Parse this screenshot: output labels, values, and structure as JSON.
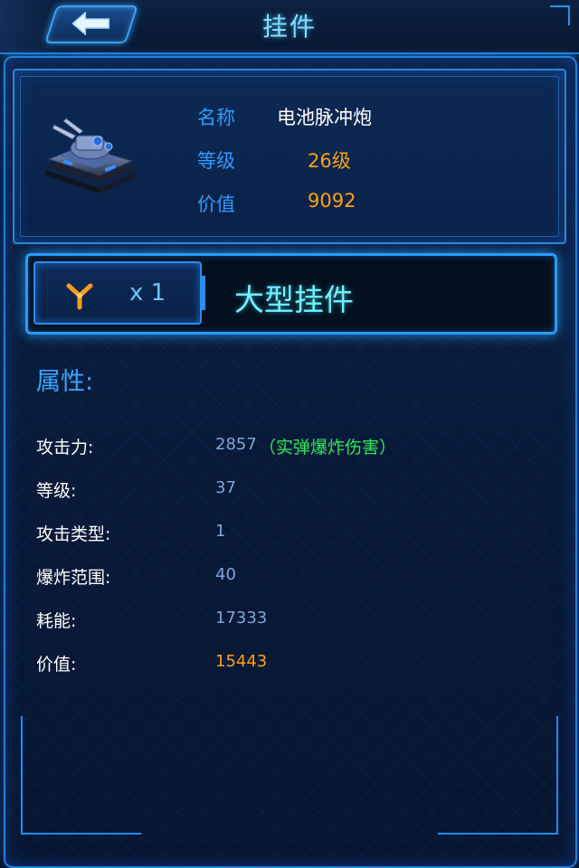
{
  "header": {
    "title": "挂件"
  },
  "item": {
    "name_label": "名称",
    "name_value": "电池脉冲炮",
    "level_label": "等级",
    "level_value": "26级",
    "value_label": "价值",
    "value_value": "9092"
  },
  "slot": {
    "count": "x 1",
    "type_name": "大型挂件"
  },
  "attributes": {
    "heading": "属性:",
    "rows": [
      {
        "label": "攻击力:",
        "value": "2857",
        "note": "（实弹爆炸伤害）"
      },
      {
        "label": "等级:",
        "value": "37"
      },
      {
        "label": "攻击类型:",
        "value": "1"
      },
      {
        "label": "爆炸范围:",
        "value": "40"
      },
      {
        "label": "耗能:",
        "value": "17333"
      },
      {
        "label": "价值:",
        "value": "15443"
      }
    ]
  },
  "colors": {
    "label_blue": "#2f9bff",
    "value_orange": "#ffa012",
    "note_green": "#2ee85c",
    "title_cyan": "#7fe1ff"
  },
  "icons": {
    "back": "back-arrow-icon",
    "slot_type": "y-connector-icon",
    "item_image": "tank-image"
  }
}
